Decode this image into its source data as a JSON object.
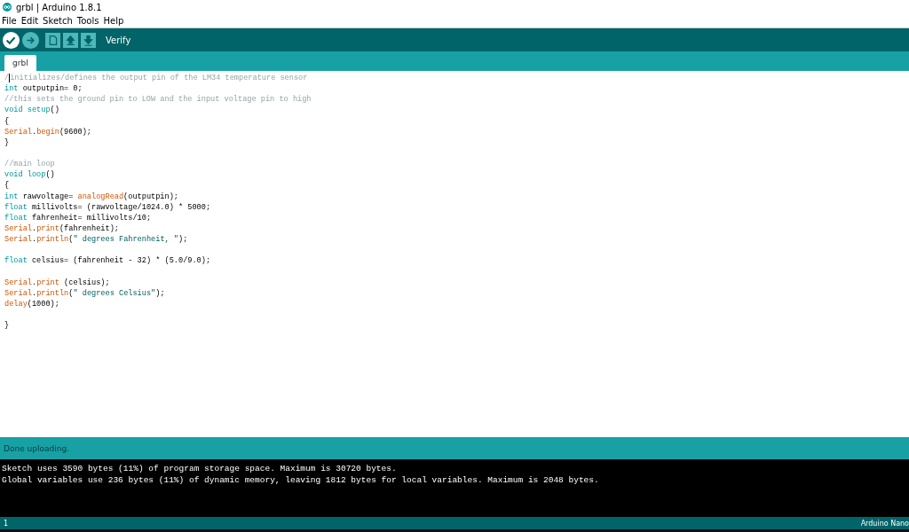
{
  "window": {
    "title": "grbl | Arduino 1.8.1"
  },
  "menu": [
    "File",
    "Edit",
    "Sketch",
    "Tools",
    "Help"
  ],
  "toolbar": {
    "buttons": [
      {
        "kind": "verify",
        "selected": true
      },
      {
        "kind": "upload",
        "selected": false
      },
      {
        "kind": "new",
        "selected": false
      },
      {
        "kind": "open",
        "selected": false
      },
      {
        "kind": "save",
        "selected": false
      }
    ],
    "hint": "Verify"
  },
  "tabs": [
    {
      "label": "grbl",
      "selected": true
    }
  ],
  "editor": {
    "lines": [
      {
        "kind": "code",
        "tokens": [
          {
            "kind": "comment",
            "text": "/"
          },
          {
            "kind": "cursor"
          },
          {
            "kind": "comment",
            "text": "initializes/defines the output pin of the LM34 temperature sensor"
          }
        ]
      },
      {
        "kind": "code",
        "tokens": [
          {
            "kind": "type",
            "text": "int"
          },
          {
            "kind": "plain",
            "text": " outputpin= 0;"
          }
        ]
      },
      {
        "kind": "code",
        "tokens": [
          {
            "kind": "comment",
            "text": "//this sets the ground pin to LOW and the input voltage pin to high"
          }
        ]
      },
      {
        "kind": "code",
        "tokens": [
          {
            "kind": "type",
            "text": "void setup"
          },
          {
            "kind": "plain",
            "text": "()"
          }
        ]
      },
      {
        "kind": "code",
        "tokens": [
          {
            "kind": "plain",
            "text": "{"
          }
        ]
      },
      {
        "kind": "code",
        "tokens": [
          {
            "kind": "func",
            "text": "Serial"
          },
          {
            "kind": "plain",
            "text": "."
          },
          {
            "kind": "func",
            "text": "begin"
          },
          {
            "kind": "plain",
            "text": "(9600);"
          }
        ]
      },
      {
        "kind": "code",
        "tokens": [
          {
            "kind": "plain",
            "text": "}"
          }
        ]
      },
      {
        "kind": "blank"
      },
      {
        "kind": "code",
        "tokens": [
          {
            "kind": "comment",
            "text": "//main loop"
          }
        ]
      },
      {
        "kind": "code",
        "tokens": [
          {
            "kind": "type",
            "text": "void loop"
          },
          {
            "kind": "plain",
            "text": "()"
          }
        ]
      },
      {
        "kind": "code",
        "tokens": [
          {
            "kind": "plain",
            "text": "{"
          }
        ]
      },
      {
        "kind": "code",
        "tokens": [
          {
            "kind": "type",
            "text": "int"
          },
          {
            "kind": "plain",
            "text": " rawvoltage= "
          },
          {
            "kind": "func",
            "text": "analogRead"
          },
          {
            "kind": "plain",
            "text": "(outputpin);"
          }
        ]
      },
      {
        "kind": "code",
        "tokens": [
          {
            "kind": "type",
            "text": "float"
          },
          {
            "kind": "plain",
            "text": " millivolts= (rawvoltage/1024.0) * 5000;"
          }
        ]
      },
      {
        "kind": "code",
        "tokens": [
          {
            "kind": "type",
            "text": "float"
          },
          {
            "kind": "plain",
            "text": " fahrenheit= millivolts/10;"
          }
        ]
      },
      {
        "kind": "code",
        "tokens": [
          {
            "kind": "func",
            "text": "Serial"
          },
          {
            "kind": "plain",
            "text": "."
          },
          {
            "kind": "func",
            "text": "print"
          },
          {
            "kind": "plain",
            "text": "(fahrenheit);"
          }
        ]
      },
      {
        "kind": "code",
        "tokens": [
          {
            "kind": "func",
            "text": "Serial"
          },
          {
            "kind": "plain",
            "text": "."
          },
          {
            "kind": "func",
            "text": "println"
          },
          {
            "kind": "plain",
            "text": "("
          },
          {
            "kind": "string",
            "text": "\" degrees Fahrenheit, \""
          },
          {
            "kind": "plain",
            "text": ");"
          }
        ]
      },
      {
        "kind": "blank"
      },
      {
        "kind": "code",
        "tokens": [
          {
            "kind": "type",
            "text": "float"
          },
          {
            "kind": "plain",
            "text": " celsius= (fahrenheit - 32) * (5.0/9.0);"
          }
        ]
      },
      {
        "kind": "blank"
      },
      {
        "kind": "code",
        "tokens": [
          {
            "kind": "func",
            "text": "Serial"
          },
          {
            "kind": "plain",
            "text": "."
          },
          {
            "kind": "func",
            "text": "print"
          },
          {
            "kind": "plain",
            "text": " (celsius);"
          }
        ]
      },
      {
        "kind": "code",
        "tokens": [
          {
            "kind": "func",
            "text": "Serial"
          },
          {
            "kind": "plain",
            "text": "."
          },
          {
            "kind": "func",
            "text": "println"
          },
          {
            "kind": "plain",
            "text": "("
          },
          {
            "kind": "string",
            "text": "\" degrees Celsius\""
          },
          {
            "kind": "plain",
            "text": ");"
          }
        ]
      },
      {
        "kind": "code",
        "tokens": [
          {
            "kind": "func",
            "text": "delay"
          },
          {
            "kind": "plain",
            "text": "(1000);"
          }
        ]
      },
      {
        "kind": "blank"
      },
      {
        "kind": "code",
        "tokens": [
          {
            "kind": "plain",
            "text": "}"
          }
        ]
      }
    ]
  },
  "status": "Done uploading.",
  "console": [
    "Sketch uses 3590 bytes (11%) of program storage space. Maximum is 30720 bytes.",
    "Global variables use 236 bytes (11%) of dynamic memory, leaving 1812 bytes for local variables. Maximum is 2048 bytes."
  ],
  "footer": {
    "line": "1",
    "board": "Arduino Nano"
  }
}
